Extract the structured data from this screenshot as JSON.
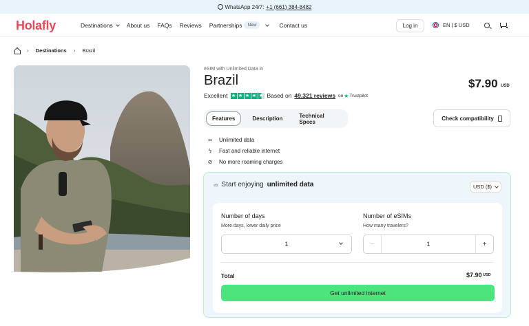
{
  "topbar": {
    "prefix": "WhatsApp 24/7:",
    "phone": "+1 (661) 384-8482"
  },
  "header": {
    "logo": "Holafly",
    "nav": [
      {
        "label": "Destinations",
        "has_dropdown": true
      },
      {
        "label": "About us"
      },
      {
        "label": "FAQs"
      },
      {
        "label": "Reviews"
      },
      {
        "label": "Partnerships",
        "badge": "New",
        "has_dropdown": true
      },
      {
        "label": "Contact us"
      }
    ],
    "login": "Log in",
    "lang_currency": "EN | $ USD"
  },
  "breadcrumb": {
    "items": [
      "Destinations",
      "Brazil"
    ]
  },
  "product": {
    "subtitle": "eSIM with Unlimited Data in",
    "title": "Brazil",
    "price": "$7.90",
    "price_currency": "USD",
    "rating_word": "Excellent",
    "rating_stars": 4.5,
    "based_on": "Based on",
    "reviews": "49,321 reviews",
    "on": "on",
    "trustpilot": "Trustpilot"
  },
  "tabs": {
    "items": [
      "Features",
      "Description",
      "Technical Specs"
    ],
    "active": "Features"
  },
  "check_compatibility": "Check compatibility",
  "features": [
    {
      "icon": "infinity-icon",
      "label": "Unlimited data"
    },
    {
      "icon": "bolt-icon",
      "label": "Fast and reliable internet"
    },
    {
      "icon": "no-roaming-icon",
      "label": "No more roaming charges"
    }
  ],
  "purchase": {
    "heading_prefix": "Start enjoying",
    "heading_strong": "unlimited data",
    "currency_select": "USD ($)",
    "days_label": "Number of days",
    "days_hint": "More days, lower daily price",
    "days_value": "1",
    "esims_label": "Number of eSIMs",
    "esims_hint": "How many travelers?",
    "esims_value": "1",
    "minus": "−",
    "plus": "+",
    "total_label": "Total",
    "total_value": "$7.90",
    "total_currency": "USD",
    "cta": "Get unlimited internet"
  },
  "colors": {
    "brand": "#e6485a",
    "cta": "#4be47d",
    "trustpilot": "#00b67a",
    "topbar_bg": "#e8f3fb",
    "box_bg": "#eef6fb"
  }
}
